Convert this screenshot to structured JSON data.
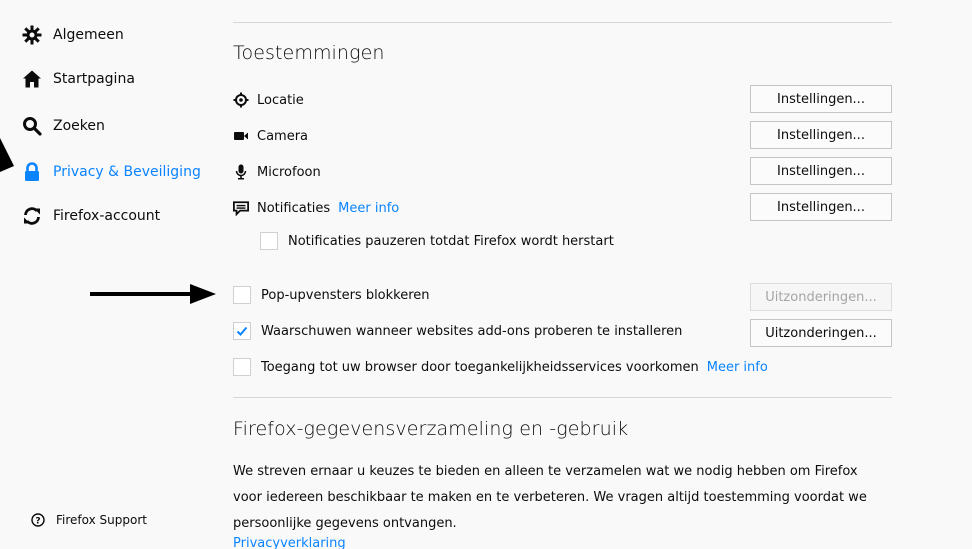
{
  "sidebar": {
    "items": [
      {
        "label": "Algemeen",
        "icon": "gear-icon"
      },
      {
        "label": "Startpagina",
        "icon": "home-icon"
      },
      {
        "label": "Zoeken",
        "icon": "search-icon"
      },
      {
        "label": "Privacy & Beveiliging",
        "icon": "lock-icon"
      },
      {
        "label": "Firefox-account",
        "icon": "sync-icon"
      }
    ],
    "support_label": "Firefox Support"
  },
  "permissions": {
    "title": "Toestemmingen",
    "rows": [
      {
        "label": "Locatie",
        "icon": "location-icon",
        "button": "Instellingen..."
      },
      {
        "label": "Camera",
        "icon": "camera-icon",
        "button": "Instellingen..."
      },
      {
        "label": "Microfoon",
        "icon": "microphone-icon",
        "button": "Instellingen..."
      },
      {
        "label": "Notificaties",
        "icon": "notification-icon",
        "button": "Instellingen...",
        "link": "Meer info"
      }
    ],
    "pause_notifications": {
      "label": "Notificaties pauzeren totdat Firefox wordt herstart",
      "checked": false
    },
    "popups": {
      "label": "Pop-upvensters blokkeren",
      "checked": false,
      "button": "Uitzonderingen..."
    },
    "addons": {
      "label": "Waarschuwen wanneer websites add-ons proberen te installeren",
      "checked": true,
      "button": "Uitzonderingen..."
    },
    "accessibility": {
      "label": "Toegang tot uw browser door toegankelijkheidsservices voorkomen",
      "checked": false,
      "link": "Meer info"
    }
  },
  "data_collection": {
    "title": "Firefox-gegevensverzameling en -gebruik",
    "description": "We streven ernaar u keuzes te bieden en alleen te verzamelen wat we nodig hebben om Firefox voor iedereen beschikbaar te maken en te verbeteren. We vragen altijd toestemming voordat we persoonlijke gegevens ontvangen.",
    "privacy_link": "Privacyverklaring"
  },
  "colors": {
    "accent": "#0a84ff",
    "background": "#f9f9fa",
    "text": "#0c0c0d"
  }
}
